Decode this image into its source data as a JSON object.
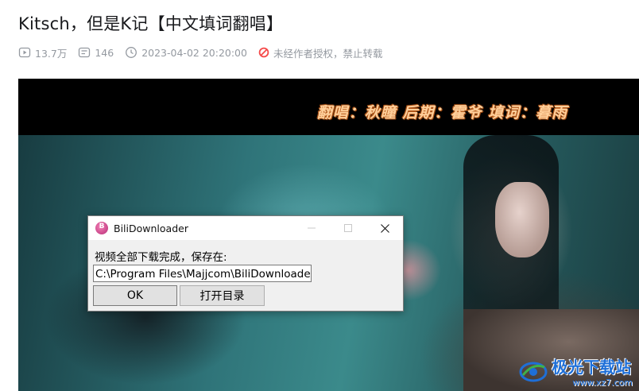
{
  "page": {
    "title": "Kitsch，但是K记【中文填词翻唱】",
    "meta": {
      "views": "13.7万",
      "danmaku": "146",
      "datetime": "2023-04-02 20:20:00",
      "copyright": "未经作者授权，禁止转载"
    }
  },
  "video": {
    "credits": "翻唱：秋瞳 后期：霍爷 填词：暮雨",
    "watermark": {
      "name": "极光下载站",
      "url": "www.xz7.com"
    }
  },
  "dialog": {
    "title": "BiliDownloader",
    "message": "视频全部下载完成，保存在:",
    "path_value": "C:\\Program Files\\Majjcom\\BiliDownloader",
    "ok_label": "OK",
    "open_dir_label": "打开目录"
  },
  "colors": {
    "meta_gray": "#9499a0",
    "warning_red": "#f54b4b",
    "credit_text": "#ffcf9a",
    "watermark_blue": "#1e6fd8",
    "dialog_bg": "#f0f0f0"
  },
  "icons": {
    "views": "play-icon",
    "danmaku": "danmaku-icon",
    "time": "clock-icon",
    "copyright": "forbidden-icon",
    "app": "bilidownloader-app-icon",
    "minimize": "minimize-icon",
    "maximize": "maximize-icon",
    "close": "close-icon"
  }
}
